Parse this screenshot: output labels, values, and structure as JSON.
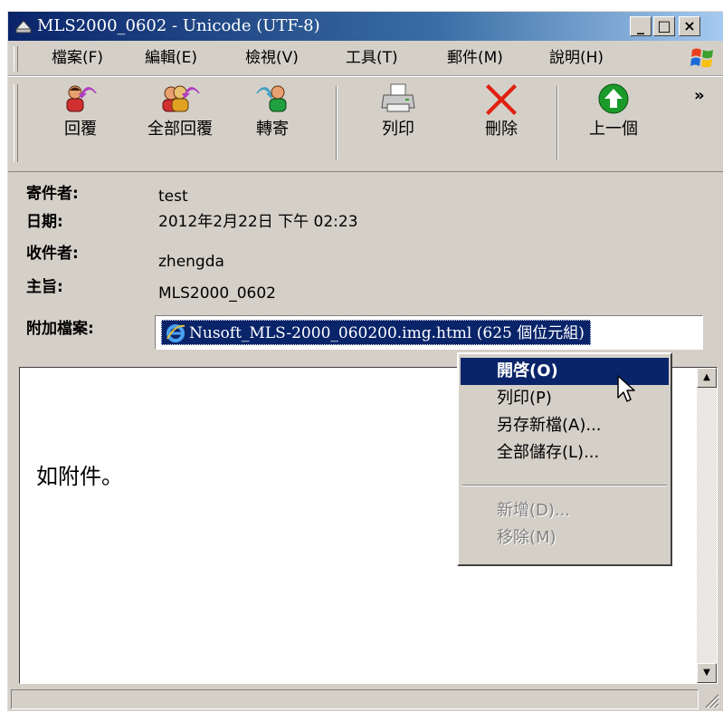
{
  "window": {
    "title": "MLS2000_0602 - Unicode (UTF-8)",
    "controls": {
      "minimize": "_",
      "maximize": "□",
      "close": "×"
    }
  },
  "menu": [
    "檔案(F)",
    "編輯(E)",
    "檢視(V)",
    "工具(T)",
    "郵件(M)",
    "說明(H)"
  ],
  "toolbar": {
    "reply": "回覆",
    "reply_all": "全部回覆",
    "forward": "轉寄",
    "print": "列印",
    "delete": "刪除",
    "previous": "上一個",
    "more": "»"
  },
  "header": {
    "from_label": "寄件者:",
    "from": "test",
    "date_label": "日期:",
    "date": "2012年2月22日 下午 02:23",
    "to_label": "收件者:",
    "to": "zhengda",
    "subject_label": "主旨:",
    "subject": "MLS2000_0602",
    "attach_label": "附加檔案:",
    "attachment": "Nusoft_MLS-2000_060200.img.html (625 個位元組)"
  },
  "body": {
    "text": "如附件。"
  },
  "context_menu": {
    "items": [
      {
        "label": "開啓(O)",
        "state": "highlighted"
      },
      {
        "label": "列印(P)",
        "state": "enabled"
      },
      {
        "label": "另存新檔(A)...",
        "state": "enabled"
      },
      {
        "label": "全部儲存(L)...",
        "state": "enabled"
      },
      {
        "label": "新增(D)...",
        "state": "disabled"
      },
      {
        "label": "移除(M)",
        "state": "disabled"
      }
    ]
  },
  "colors": {
    "titlebar_start": "#0a246a",
    "titlebar_end": "#a6caf0",
    "face": "#d4d0c8",
    "highlight": "#0a246a",
    "delete_red": "#e02010",
    "up_green": "#1a9a2a"
  }
}
